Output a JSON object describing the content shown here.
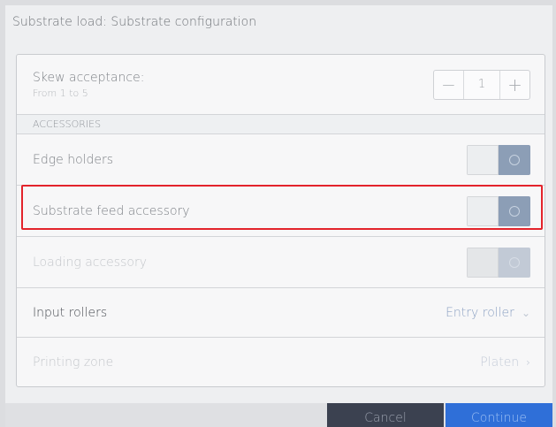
{
  "title": "Substrate load: Substrate configuration",
  "skew": {
    "label": "Skew acceptance:",
    "range": "From 1 to 5",
    "decrement": "−",
    "value": "1",
    "increment": "+"
  },
  "accessories_header": "ACCESSORIES",
  "edge_holders": {
    "label": "Edge holders",
    "state": "off"
  },
  "substrate_feed": {
    "label": "Substrate feed accessory",
    "state": "off"
  },
  "loading_accessory": {
    "label": "Loading accessory",
    "state": "off",
    "disabled": true
  },
  "input_rollers": {
    "label": "Input rollers",
    "value": "Entry roller",
    "chevron": "⌄"
  },
  "printing_zone": {
    "label": "Printing zone",
    "value": "Platen",
    "chevron": "›",
    "disabled": true
  },
  "footer": {
    "cancel": "Cancel",
    "continue": "Continue"
  },
  "colors": {
    "accent": "#2f6fd8",
    "highlight": "#e3232b",
    "toggle": "#8c9eb6"
  }
}
